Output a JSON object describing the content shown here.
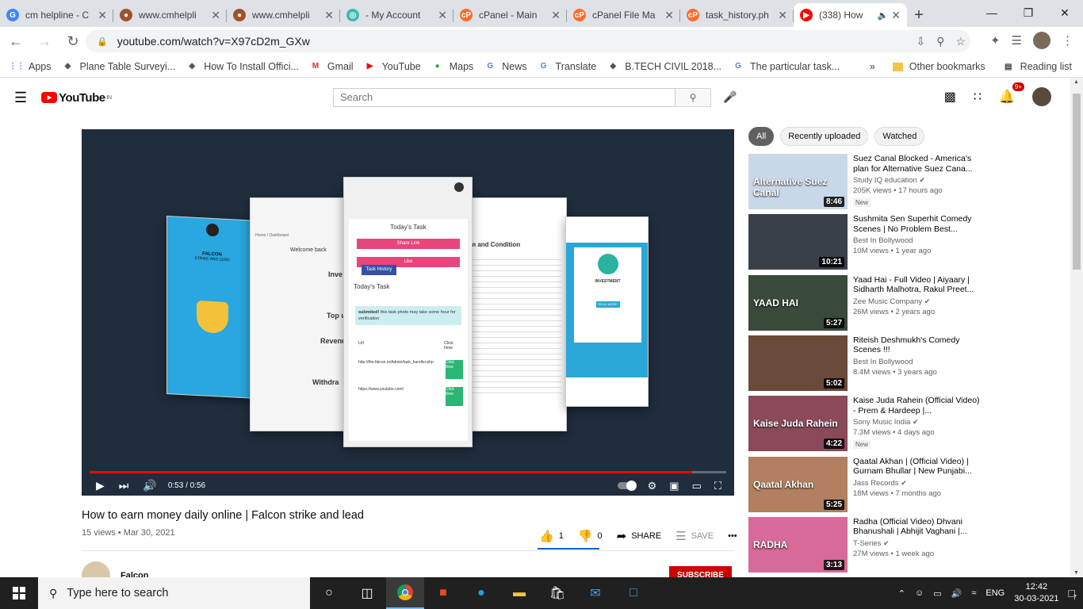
{
  "browser": {
    "tabs": [
      {
        "title": "cm helpline - C",
        "favicon": "google-icon",
        "color": "#4285f4",
        "glyph": "G"
      },
      {
        "title": "www.cmhelpli",
        "favicon": "site-icon",
        "color": "#a0522d",
        "glyph": "●"
      },
      {
        "title": "www.cmhelpli",
        "favicon": "site-icon",
        "color": "#a0522d",
        "glyph": "●"
      },
      {
        "title": "- My Account",
        "favicon": "account-icon",
        "color": "#3fb8b0",
        "glyph": "◎"
      },
      {
        "title": "cPanel - Main",
        "favicon": "cpanel-icon",
        "color": "#ff6c2c",
        "glyph": "cP"
      },
      {
        "title": "cPanel File Ma",
        "favicon": "cpanel-icon",
        "color": "#ff6c2c",
        "glyph": "cP"
      },
      {
        "title": "task_history.ph",
        "favicon": "cpanel-icon",
        "color": "#ff6c2c",
        "glyph": "cP"
      },
      {
        "title": "(338) How",
        "favicon": "youtube-icon",
        "color": "#ff0000",
        "glyph": "▶",
        "active": true
      }
    ],
    "url": "youtube.com/watch?v=X97cD2m_GXw",
    "bookmarks": [
      {
        "label": "Apps",
        "icon": "apps-icon"
      },
      {
        "label": "Plane Table Surveyi...",
        "icon": "bookmark-icon"
      },
      {
        "label": "How To Install Offici...",
        "icon": "bookmark-icon"
      },
      {
        "label": "Gmail",
        "icon": "gmail-icon"
      },
      {
        "label": "YouTube",
        "icon": "youtube-icon"
      },
      {
        "label": "Maps",
        "icon": "maps-icon"
      },
      {
        "label": "News",
        "icon": "news-icon"
      },
      {
        "label": "Translate",
        "icon": "translate-icon"
      },
      {
        "label": "B.TECH CIVIL 2018...",
        "icon": "bookmark-icon"
      },
      {
        "label": "The particular task...",
        "icon": "google-icon"
      }
    ],
    "overflow": "»",
    "other_bookmarks": "Other bookmarks",
    "reading_list": "Reading list"
  },
  "youtube": {
    "logo": "YouTube",
    "region": "IN",
    "search_placeholder": "Search",
    "notif_count": "9+"
  },
  "player": {
    "time": "0:53 / 0:56",
    "progress": 0.946,
    "slides": {
      "falcon_title": "FALCON",
      "falcon_sub": "STRIKE AND LEAD",
      "welcome": "Welcome back",
      "dashboard": "Home / Dashboard",
      "invest": "Inve",
      "topup": "Top u",
      "revenue": "Revenu",
      "withdraw": "Withdra",
      "todays_task": "Today's Task",
      "share_link": "Share Link",
      "like": "Like",
      "task_history": "Task History",
      "todays_task2": "Today's Task",
      "submitted": "submited!",
      "submitted_rest": "this task photo may take some hour for verification",
      "col_url": "Url",
      "col_click": "Click Now",
      "url1": "http://the-falcon.in/Admin/task_handler.php",
      "url2": "https://www.youtube.com/",
      "click_now": "Click Now",
      "terms_title": "m and Condition",
      "investment": "INVESTMENT",
      "read_more": "READ MORE"
    }
  },
  "video": {
    "title": "How to earn money daily online | Falcon strike and lead",
    "meta": "15 views • Mar 30, 2021",
    "likes": "1",
    "dislikes": "0",
    "share": "SHARE",
    "save": "SAVE",
    "more": "•••",
    "channel": "Falcon",
    "subscribe": "SUBSCRIBE"
  },
  "chips": [
    "All",
    "Recently uploaded",
    "Watched"
  ],
  "recommendations": [
    {
      "title": "Suez Canal Blocked - America's plan for Alternative Suez Cana...",
      "channel": "Study IQ education",
      "verified": true,
      "views": "205K views • 17 hours ago",
      "new": "New",
      "duration": "8:46",
      "thumb_bg": "#c8d8e8",
      "thumb_text": "Alternative Suez Canal"
    },
    {
      "title": "Sushmita Sen Superhit Comedy Scenes | No Problem Best...",
      "channel": "Best In Bollywood",
      "verified": false,
      "views": "10M views • 1 year ago",
      "new": "",
      "duration": "10:21",
      "thumb_bg": "#3a4048",
      "thumb_text": ""
    },
    {
      "title": "Yaad Hai - Full Video | Aiyaary | Sidharth Malhotra, Rakul Preet...",
      "channel": "Zee Music Company",
      "verified": true,
      "views": "26M views • 2 years ago",
      "new": "",
      "duration": "5:27",
      "thumb_bg": "#3a4a3a",
      "thumb_text": "YAAD HAI"
    },
    {
      "title": "Riteish Deshmukh's Comedy Scenes !!!",
      "channel": "Best In Bollywood",
      "verified": false,
      "views": "8.4M views • 3 years ago",
      "new": "",
      "duration": "5:02",
      "thumb_bg": "#6a4a3a",
      "thumb_text": ""
    },
    {
      "title": "Kaise Juda Rahein (Official Video) - Prem & Hardeep |...",
      "channel": "Sony Music India",
      "verified": true,
      "views": "7.3M views • 4 days ago",
      "new": "New",
      "duration": "4:22",
      "thumb_bg": "#8a4a5a",
      "thumb_text": "Kaise Juda Rahein"
    },
    {
      "title": "Qaatal Akhan | (Official Video) | Gurnam Bhullar | New Punjabi...",
      "channel": "Jass Records",
      "verified": true,
      "views": "18M views • 7 months ago",
      "new": "",
      "duration": "5:25",
      "thumb_bg": "#b08060",
      "thumb_text": "Qaatal Akhan"
    },
    {
      "title": "Radha (Official Video) Dhvani Bhanushali | Abhijit Vaghani |...",
      "channel": "T-Series",
      "verified": true,
      "views": "27M views • 1 week ago",
      "new": "",
      "duration": "3:13",
      "thumb_bg": "#d86a9a",
      "thumb_text": "RADHA"
    }
  ],
  "taskbar": {
    "search_placeholder": "Type here to search",
    "lang": "ENG",
    "time": "12:42",
    "date": "30-03-2021",
    "notif": "7"
  },
  "colors": {
    "youtube_red": "#ff0000",
    "subscribe_red": "#cc0000",
    "like_blue": "#065fd4",
    "player_bg": "#1f2d3d",
    "taskbar": "#202020"
  }
}
